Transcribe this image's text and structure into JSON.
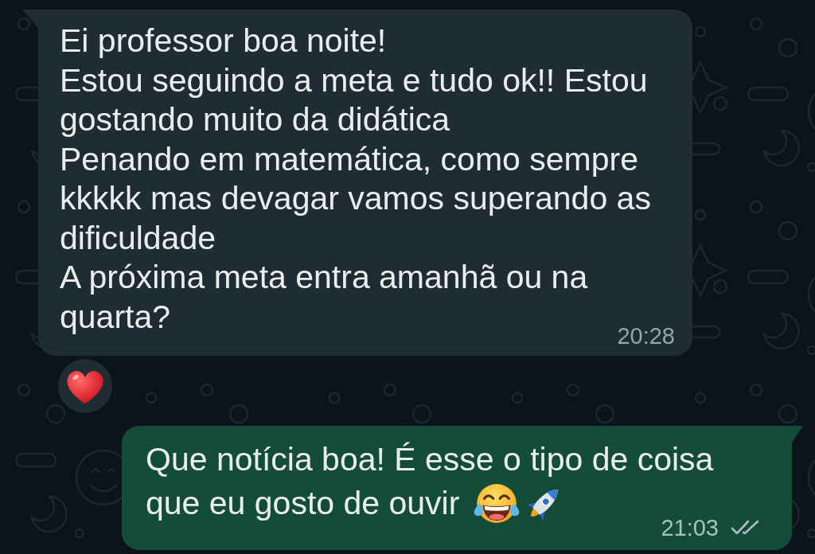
{
  "messages": [
    {
      "kind": "incoming",
      "lines": [
        "Ei professor boa noite!",
        "Estou seguindo a meta e tudo ok!! Estou gostando muito da didática",
        "Penando em matemática, como sempre kkkkk mas devagar vamos superando as dificuldade",
        "A próxima meta entra amanhã ou na quarta?"
      ],
      "time": "20:28",
      "reacted": true
    },
    {
      "kind": "outgoing",
      "lines": [
        "Que notícia boa! É esse o tipo de coisa",
        "que eu gosto de ouvir"
      ],
      "emoji": [
        {
          "kind": "tears_of_joy"
        },
        {
          "kind": "rocket"
        }
      ],
      "time": "21:03",
      "delivered": true,
      "read": false,
      "reacted": false
    }
  ]
}
